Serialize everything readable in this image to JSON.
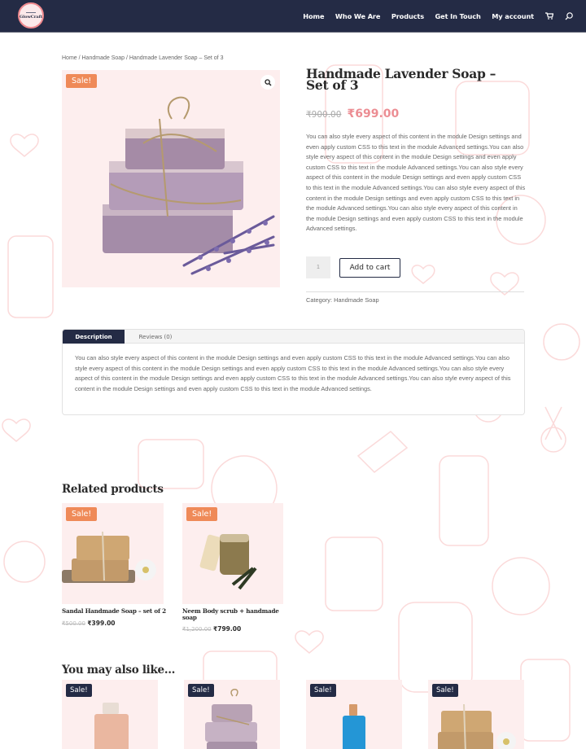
{
  "header": {
    "logo_text": "GlowCraft",
    "nav": [
      "Home",
      "Who We Are",
      "Products",
      "Get In Touch",
      "My account"
    ],
    "icons": [
      "cart-icon",
      "search-icon"
    ]
  },
  "breadcrumb": "Home / Handmade Soap / Handmade Lavender Soap – Set of 3",
  "product": {
    "sale_badge": "Sale!",
    "title": "Handmade Lavender Soap – Set of 3",
    "old_price": "₹900.00",
    "new_price": "₹699.00",
    "short_description": "You can also style every aspect of this content in the module Design settings and even apply custom CSS to this text in the module Advanced settings.You can also style every aspect of this content in the module Design settings and even apply custom CSS to this text in the module Advanced settings.You can also style every aspect of this content in the module Design settings and even apply custom CSS to this text in the module Advanced settings.You can also style every aspect of this content in the module Design settings and even apply custom CSS to this text in the module Advanced settings.You can also style every aspect of this content in the module Design settings and even apply custom CSS to this text in the module Advanced settings.",
    "quantity": "1",
    "add_to_cart": "Add to cart",
    "category_label": "Category:",
    "category": "Handmade Soap"
  },
  "tabs": {
    "items": [
      "Description",
      "Reviews (0)"
    ],
    "active": "Description",
    "description": "You can also style every aspect of this content in the module Design settings and even apply custom CSS to this text in the module Advanced settings.You can also style every aspect of this content in the module Design settings and even apply custom CSS to this text in the module Advanced settings.You can also style every aspect of this content in the module Design settings and even apply custom CSS to this text in the module Advanced settings.You can also style every aspect of this content in the module Design settings and even apply custom CSS to this text in the module Advanced settings."
  },
  "related": {
    "title": "Related products",
    "items": [
      {
        "badge": "Sale!",
        "name": "Sandal Handmade Soap – set of 2",
        "old_price": "₹500.00",
        "new_price": "₹399.00"
      },
      {
        "badge": "Sale!",
        "name": "Neem Body scrub + handmade soap",
        "old_price": "₹1,200.00",
        "new_price": "₹799.00"
      }
    ]
  },
  "upsells": {
    "title": "You may also like…",
    "items": [
      {
        "badge": "Sale!"
      },
      {
        "badge": "Sale!"
      },
      {
        "badge": "Sale!"
      },
      {
        "badge": "Sale!"
      }
    ]
  },
  "colors": {
    "header_bg": "#242b45",
    "sale_orange": "#ef8a58",
    "sale_dark": "#242b45",
    "price_pink": "#ec8d93",
    "image_bg": "#fdeeee"
  }
}
